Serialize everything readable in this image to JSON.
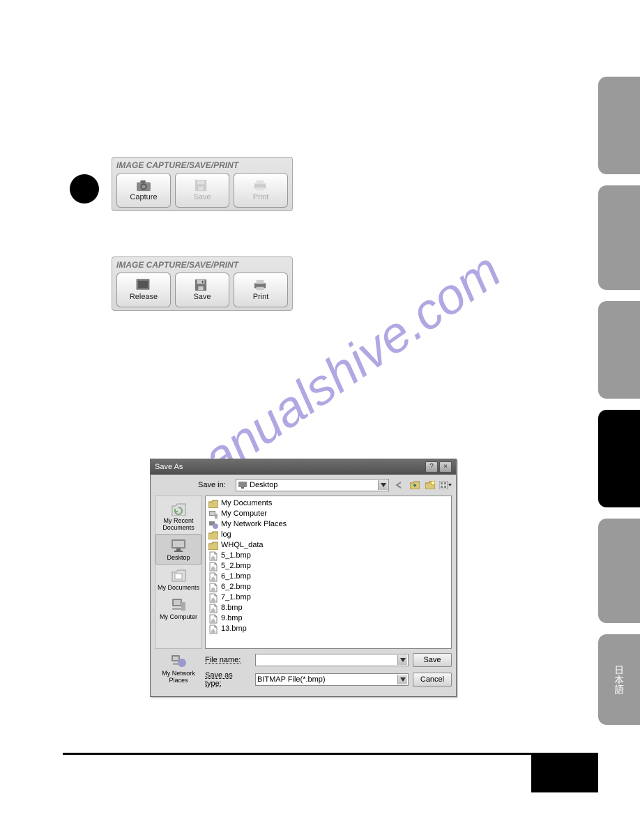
{
  "watermark": "manualshive.com",
  "panels": {
    "title": "IMAGE CAPTURE/SAVE/PRINT",
    "before": {
      "btn1": "Capture",
      "btn2": "Save",
      "btn3": "Print"
    },
    "after": {
      "btn1": "Release",
      "btn2": "Save",
      "btn3": "Print"
    }
  },
  "dialog": {
    "title": "Save As",
    "saveInLabel": "Save in:",
    "saveInValue": "Desktop",
    "places": {
      "recent": "My Recent Documents",
      "desktop": "Desktop",
      "mydocs": "My Documents",
      "mycomp": "My Computer",
      "network": "My Network Places"
    },
    "files": [
      {
        "icon": "folder",
        "name": "My Documents"
      },
      {
        "icon": "computer",
        "name": "My Computer"
      },
      {
        "icon": "network",
        "name": "My Network Places"
      },
      {
        "icon": "folder",
        "name": "log"
      },
      {
        "icon": "folder",
        "name": "WHQL_data"
      },
      {
        "icon": "image",
        "name": "5_1.bmp"
      },
      {
        "icon": "image",
        "name": "5_2.bmp"
      },
      {
        "icon": "image",
        "name": "6_1.bmp"
      },
      {
        "icon": "image",
        "name": "6_2.bmp"
      },
      {
        "icon": "image",
        "name": "7_1.bmp"
      },
      {
        "icon": "image",
        "name": "8.bmp"
      },
      {
        "icon": "image",
        "name": "9.bmp"
      },
      {
        "icon": "image",
        "name": "13.bmp"
      }
    ],
    "fileNameLabel": "File name:",
    "fileNameValue": "",
    "saveTypeLabel": "Save as type:",
    "saveTypeValue": "BITMAP File(*.bmp)",
    "saveBtn": "Save",
    "cancelBtn": "Cancel"
  },
  "sideTab6": "日本語"
}
